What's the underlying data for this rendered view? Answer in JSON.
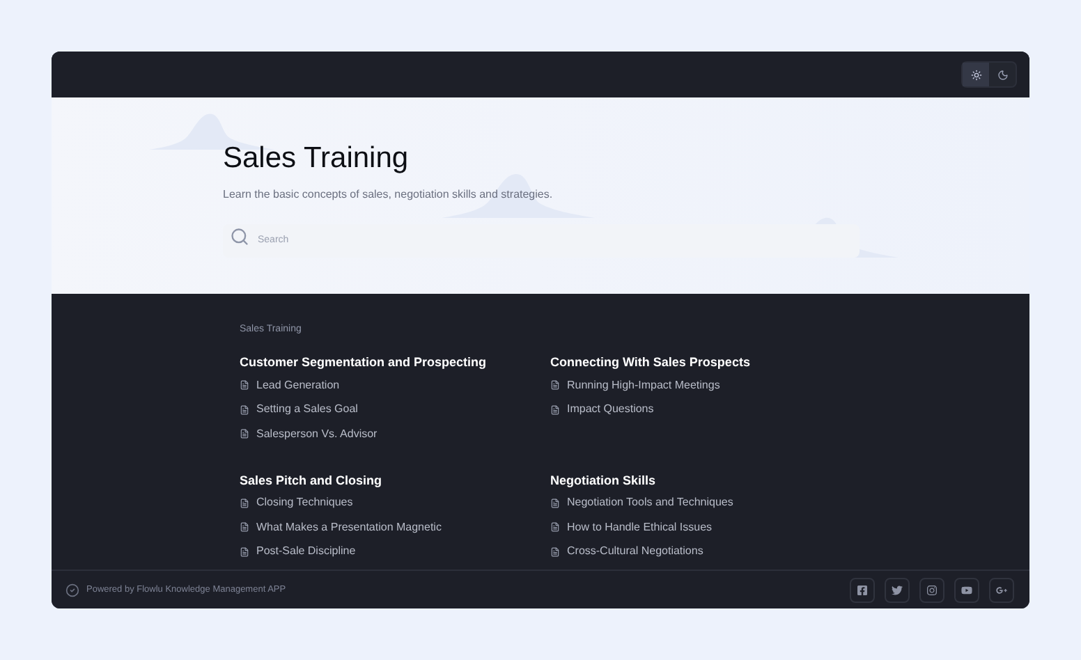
{
  "theme_toggle": [
    {
      "kind": "sun",
      "selected": true
    },
    {
      "kind": "moon",
      "selected": false
    }
  ],
  "hero": {
    "title": "Sales Training",
    "subtitle": "Learn the basic concepts of sales, negotiation skills and strategies.",
    "search": {
      "placeholder": "Search"
    }
  },
  "breadcrumb": "Sales Training",
  "sections": [
    {
      "title": "Customer Segmentation and Prospecting",
      "articles": [
        "Lead Generation",
        "Setting a Sales Goal",
        "Salesperson Vs. Advisor"
      ]
    },
    {
      "title": "Connecting With Sales Prospects",
      "articles": [
        "Running High-Impact Meetings",
        "Impact Questions"
      ]
    },
    {
      "title": "Sales Pitch and Closing",
      "articles": [
        "Closing Techniques",
        "What Makes a Presentation Magnetic",
        "Post-Sale Discipline"
      ]
    },
    {
      "title": "Negotiation Skills",
      "articles": [
        "Negotiation Tools and Techniques",
        "How to Handle Ethical Issues",
        "Cross-Cultural Negotiations"
      ]
    }
  ],
  "footer": {
    "powered_by": "Powered by Flowlu Knowledge Management APP",
    "social": [
      {
        "kind": "facebook"
      },
      {
        "kind": "twitter"
      },
      {
        "kind": "instagram"
      },
      {
        "kind": "youtube"
      },
      {
        "kind": "google-plus"
      }
    ]
  }
}
